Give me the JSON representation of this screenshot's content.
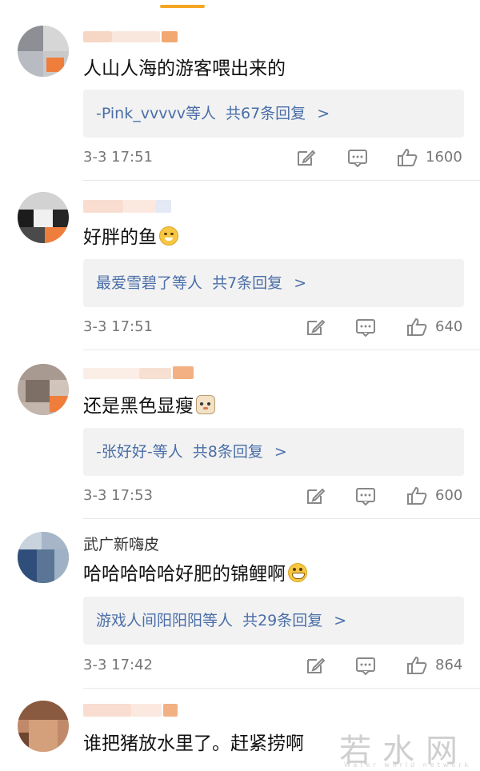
{
  "comments": [
    {
      "username": "",
      "text": "人山人海的游客喂出来的",
      "reply": {
        "summary": "-Pink_vvvvv等人",
        "count": "共67条回复",
        "chevron": ">"
      },
      "date": "3-3 17:51",
      "likes": "1600"
    },
    {
      "username": "",
      "text": "好胖的鱼",
      "emoji": "smile-emoji",
      "reply": {
        "summary": "最爱雪碧了等人",
        "count": "共7条回复",
        "chevron": ">"
      },
      "date": "3-3 17:51",
      "likes": "640"
    },
    {
      "username": "",
      "text": "还是黑色显瘦",
      "emoji": "cat-emoji",
      "reply": {
        "summary": "-张好好-等人",
        "count": "共8条回复",
        "chevron": ">"
      },
      "date": "3-3 17:53",
      "likes": "600"
    },
    {
      "username": "武广新嗨皮",
      "text": "哈哈哈哈哈好肥的锦鲤啊",
      "emoji": "grin-emoji",
      "reply": {
        "summary": "游戏人间阳阳阳等人",
        "count": "共29条回复",
        "chevron": ">"
      },
      "date": "3-3 17:42",
      "likes": "864"
    },
    {
      "username": "",
      "text": "谁把猪放水里了。赶紧捞啊"
    }
  ],
  "icons": {
    "edit": "edit-icon",
    "comment": "comment-icon",
    "like": "like-icon"
  },
  "colors": {
    "link": "#4a6ea8",
    "accent": "#f5a623",
    "reply_bg": "#f2f2f2"
  },
  "watermark": {
    "text": "若水网",
    "sub": "Water world network"
  }
}
